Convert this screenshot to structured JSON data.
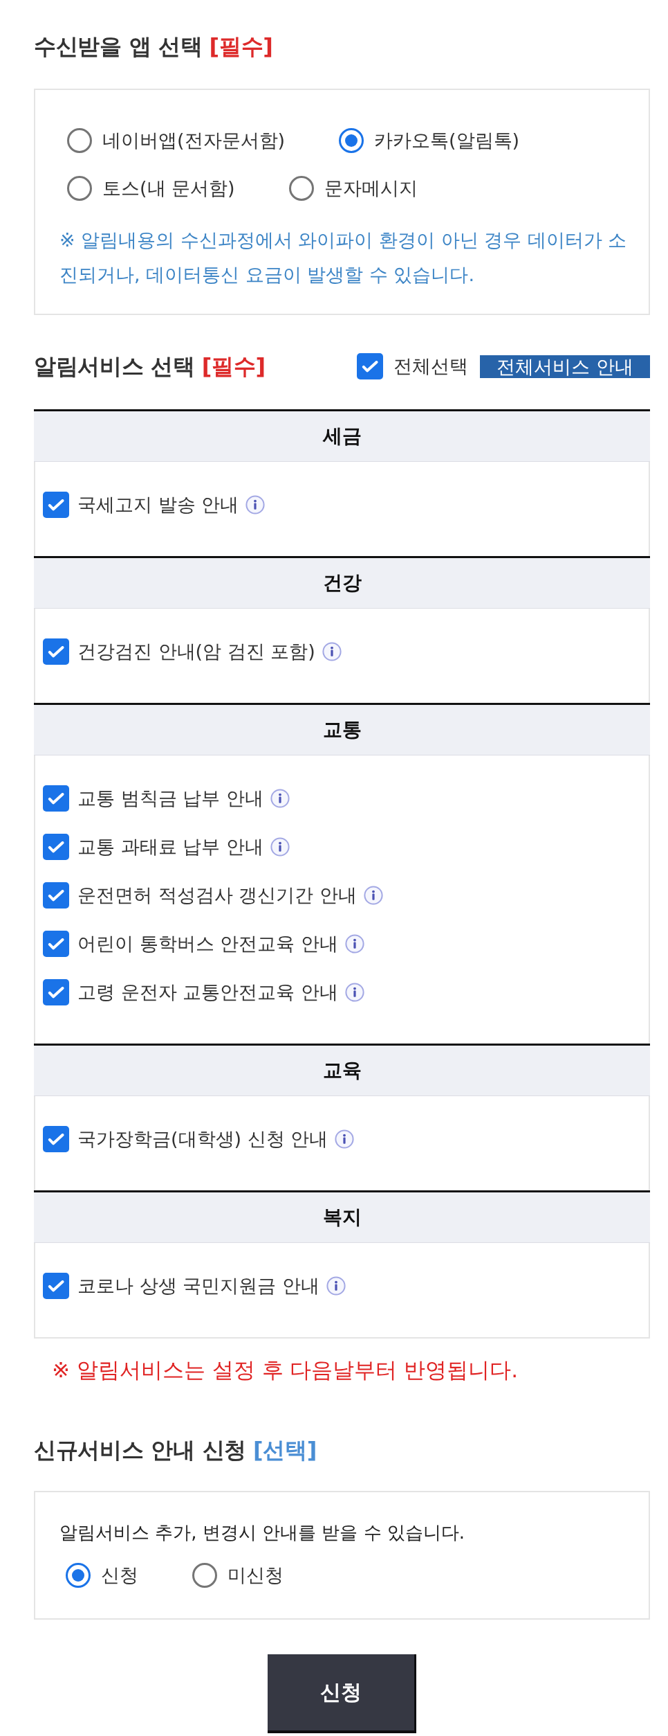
{
  "app_section": {
    "title": "수신받을 앱 선택",
    "tag": {
      "text": "[필수]",
      "kind": "required"
    },
    "options": [
      {
        "label": "네이버앱(전자문서함)",
        "selected": false
      },
      {
        "label": "카카오톡(알림톡)",
        "selected": true
      },
      {
        "label": "토스(내 문서함)",
        "selected": false
      },
      {
        "label": "문자메시지",
        "selected": false
      }
    ],
    "note": "※ 알림내용의 수신과정에서 와이파이 환경이 아닌 경우 데이터가 소진되거나, 데이터통신 요금이 발생할 수 있습니다."
  },
  "service_section": {
    "title": "알림서비스 선택",
    "tag": {
      "text": "[필수]",
      "kind": "required"
    },
    "select_all": {
      "label": "전체선택",
      "checked": true
    },
    "guide_button": "전체서비스 안내",
    "categories": [
      {
        "name": "세금",
        "items": [
          {
            "label": "국세고지 발송 안내",
            "checked": true
          }
        ]
      },
      {
        "name": "건강",
        "items": [
          {
            "label": "건강검진 안내(암 검진 포함)",
            "checked": true
          }
        ]
      },
      {
        "name": "교통",
        "items": [
          {
            "label": "교통 범칙금 납부 안내",
            "checked": true
          },
          {
            "label": "교통 과태료 납부 안내",
            "checked": true
          },
          {
            "label": "운전면허 적성검사 갱신기간 안내",
            "checked": true
          },
          {
            "label": "어린이 통학버스 안전교육 안내",
            "checked": true
          },
          {
            "label": "고령 운전자 교통안전교육 안내",
            "checked": true
          }
        ]
      },
      {
        "name": "교육",
        "items": [
          {
            "label": "국가장학금(대학생) 신청 안내",
            "checked": true
          }
        ]
      },
      {
        "name": "복지",
        "items": [
          {
            "label": "코로나 상생 국민지원금 안내",
            "checked": true
          }
        ]
      }
    ],
    "notice": "※ 알림서비스는 설정 후 다음날부터 반영됩니다."
  },
  "new_service_section": {
    "title": "신규서비스 안내 신청",
    "tag": {
      "text": "[선택]",
      "kind": "optional"
    },
    "description": "알림서비스 추가, 변경시 안내를 받을 수 있습니다.",
    "options": [
      {
        "label": "신청",
        "selected": true
      },
      {
        "label": "미신청",
        "selected": false
      }
    ]
  },
  "submit_button": "신청"
}
